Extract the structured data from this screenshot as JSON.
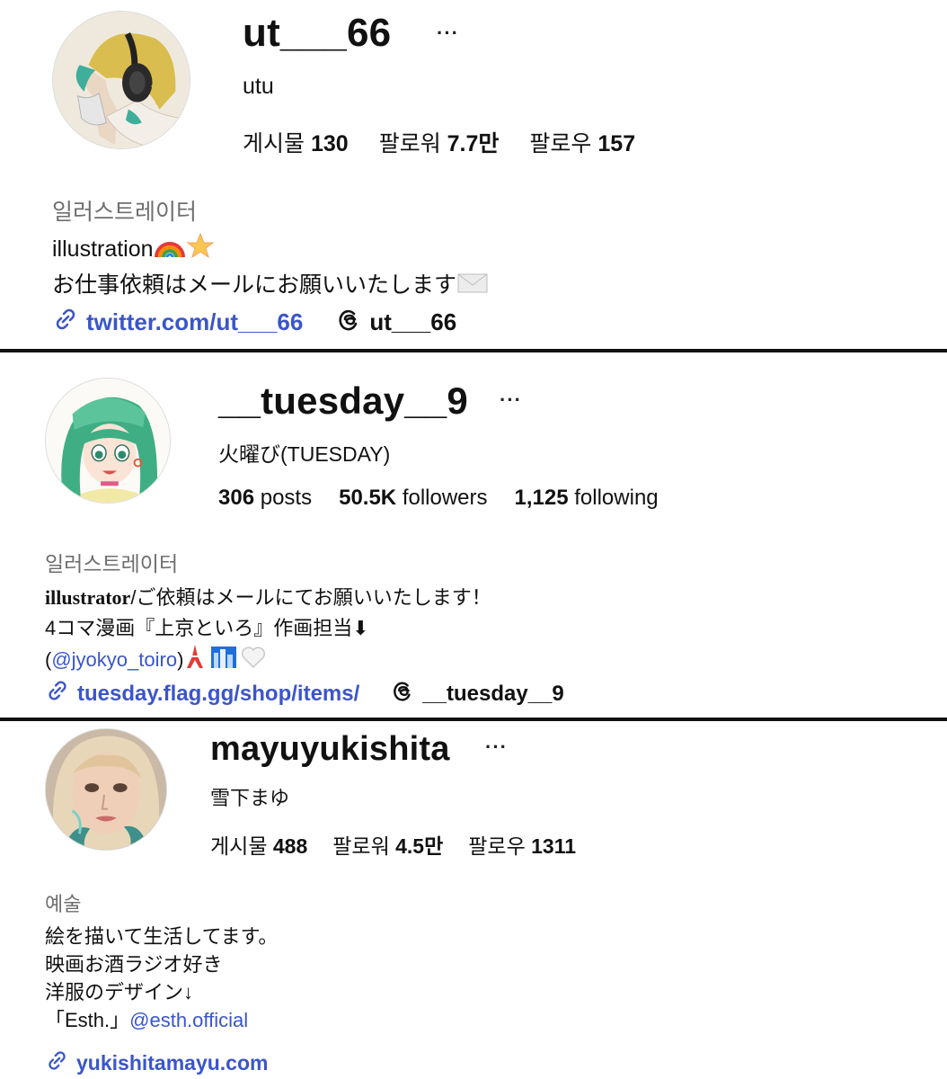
{
  "profiles": [
    {
      "username": "ut___66",
      "more": "···",
      "fullname": "utu",
      "stats": [
        {
          "label": "게시물",
          "value": "130"
        },
        {
          "label": "팔로워",
          "value": "7.7만"
        },
        {
          "label": "팔로우",
          "value": "157"
        }
      ],
      "category": "일러스트레이터",
      "bio": {
        "line1": "illustration",
        "line2": "お仕事依頼はメールにお願いいたします"
      },
      "link": "twitter.com/ut___66",
      "threads": "ut___66"
    },
    {
      "username": "__tuesday__9",
      "more": "···",
      "fullname": "火曜び(TUESDAY)",
      "stats": [
        {
          "value": "306",
          "label": "posts"
        },
        {
          "value": "50.5K",
          "label": "followers"
        },
        {
          "value": "1,125",
          "label": "following"
        }
      ],
      "category": "일러스트레이터",
      "bio": {
        "line1_bold": "illustrator",
        "line1_rest": "/ご依頼はメールにてお願いいたします！",
        "line2": "4コマ漫画『上京といろ』作画担当⬇",
        "line3_open": "(",
        "line3_mention": "@jyokyo_toiro",
        "line3_close": ")"
      },
      "link": "tuesday.flag.gg/shop/items/",
      "threads": "__tuesday__9"
    },
    {
      "username": "mayuyukishita",
      "more": "···",
      "fullname": "雪下まゆ",
      "stats": [
        {
          "label": "게시물",
          "value": "488"
        },
        {
          "label": "팔로워",
          "value": "4.5만"
        },
        {
          "label": "팔로우",
          "value": "1311"
        }
      ],
      "category": "예술",
      "bio": {
        "line1": "絵を描いて生活してます。",
        "line2": "映画お酒ラジオ好き",
        "line3": "洋服のデザイン↓",
        "line4_text": "「Esth.」",
        "line4_mention": "@esth.official"
      },
      "link": "yukishitamayu.com"
    }
  ],
  "colors": {
    "link": "#3b55c9",
    "category": "#6e6e6e",
    "divider": "#111111"
  },
  "icons": [
    "link-icon",
    "threads-icon",
    "rainbow-emoji",
    "star-emoji",
    "envelope-emoji",
    "tokyo-tower-emoji",
    "cityscape-emoji",
    "white-heart-emoji"
  ]
}
